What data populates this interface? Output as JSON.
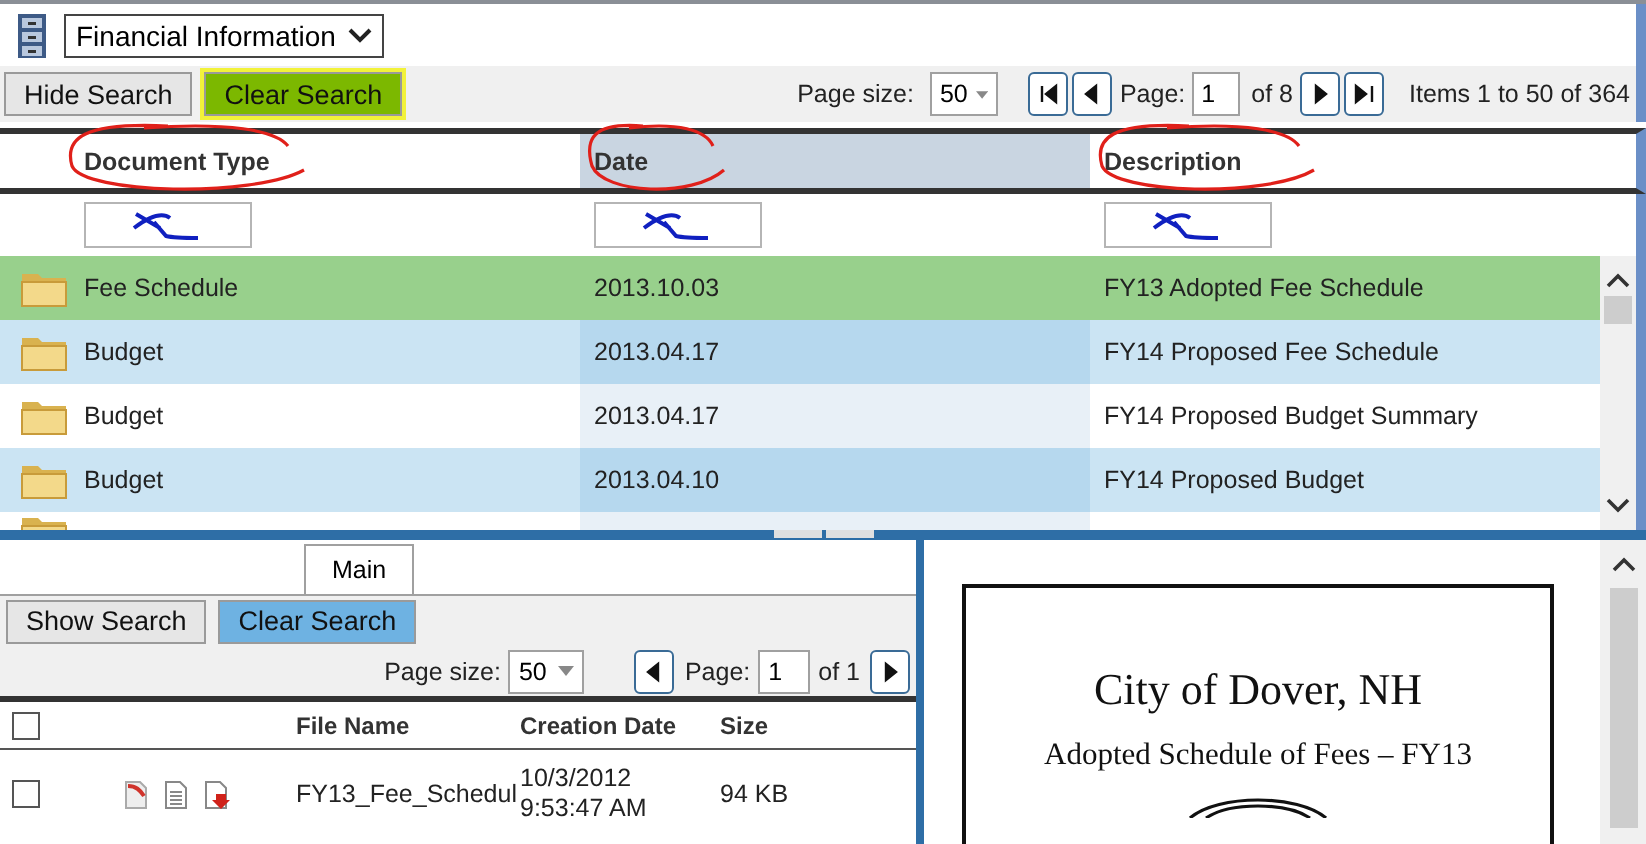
{
  "library": {
    "selected_option": "Financial Information"
  },
  "toolbar": {
    "hide_search": "Hide Search",
    "clear_search": {
      "label": "Clear Search",
      "highlighted": true
    },
    "page_size_label": "Page size:",
    "page_size": "50",
    "page_label": "Page:",
    "page": "1",
    "page_count": "of 8",
    "items_summary": "Items 1 to 50 of 364"
  },
  "columns": [
    {
      "label": "Document Type",
      "circled": true,
      "sorted": false,
      "filter_scribbled": true
    },
    {
      "label": "Date",
      "circled": true,
      "sorted": true,
      "filter_scribbled": true
    },
    {
      "label": "Description",
      "circled": true,
      "sorted": false,
      "filter_scribbled": true
    }
  ],
  "rows": [
    {
      "document_type": "Fee Schedule",
      "date": "2013.10.03",
      "description": "FY13 Adopted Fee Schedule",
      "selected": true
    },
    {
      "document_type": "Budget",
      "date": "2013.04.17",
      "description": "FY14 Proposed Fee Schedule",
      "selected": false
    },
    {
      "document_type": "Budget",
      "date": "2013.04.17",
      "description": "FY14 Proposed Budget Summary",
      "selected": false
    },
    {
      "document_type": "Budget",
      "date": "2013.04.10",
      "description": "FY14 Proposed Budget",
      "selected": false
    }
  ],
  "files_panel": {
    "tabs": [
      {
        "label": "Main",
        "selected": true
      }
    ],
    "show_search": "Show Search",
    "clear_search": "Clear Search",
    "page_size_label": "Page size:",
    "page_size": "50",
    "page_label": "Page:",
    "page": "1",
    "page_count": "of 1",
    "select_all_checked": false,
    "columns": [
      "File Name",
      "Creation Date",
      "Size"
    ],
    "files": [
      {
        "checked": false,
        "file_name": "FY13_Fee_Schedul",
        "creation_date": "10/3/2012",
        "creation_time": "9:53:47 AM",
        "size": "94 KB"
      }
    ]
  },
  "preview": {
    "title": "City of Dover, NH",
    "subtitle": "Adopted Schedule of Fees – FY13"
  }
}
